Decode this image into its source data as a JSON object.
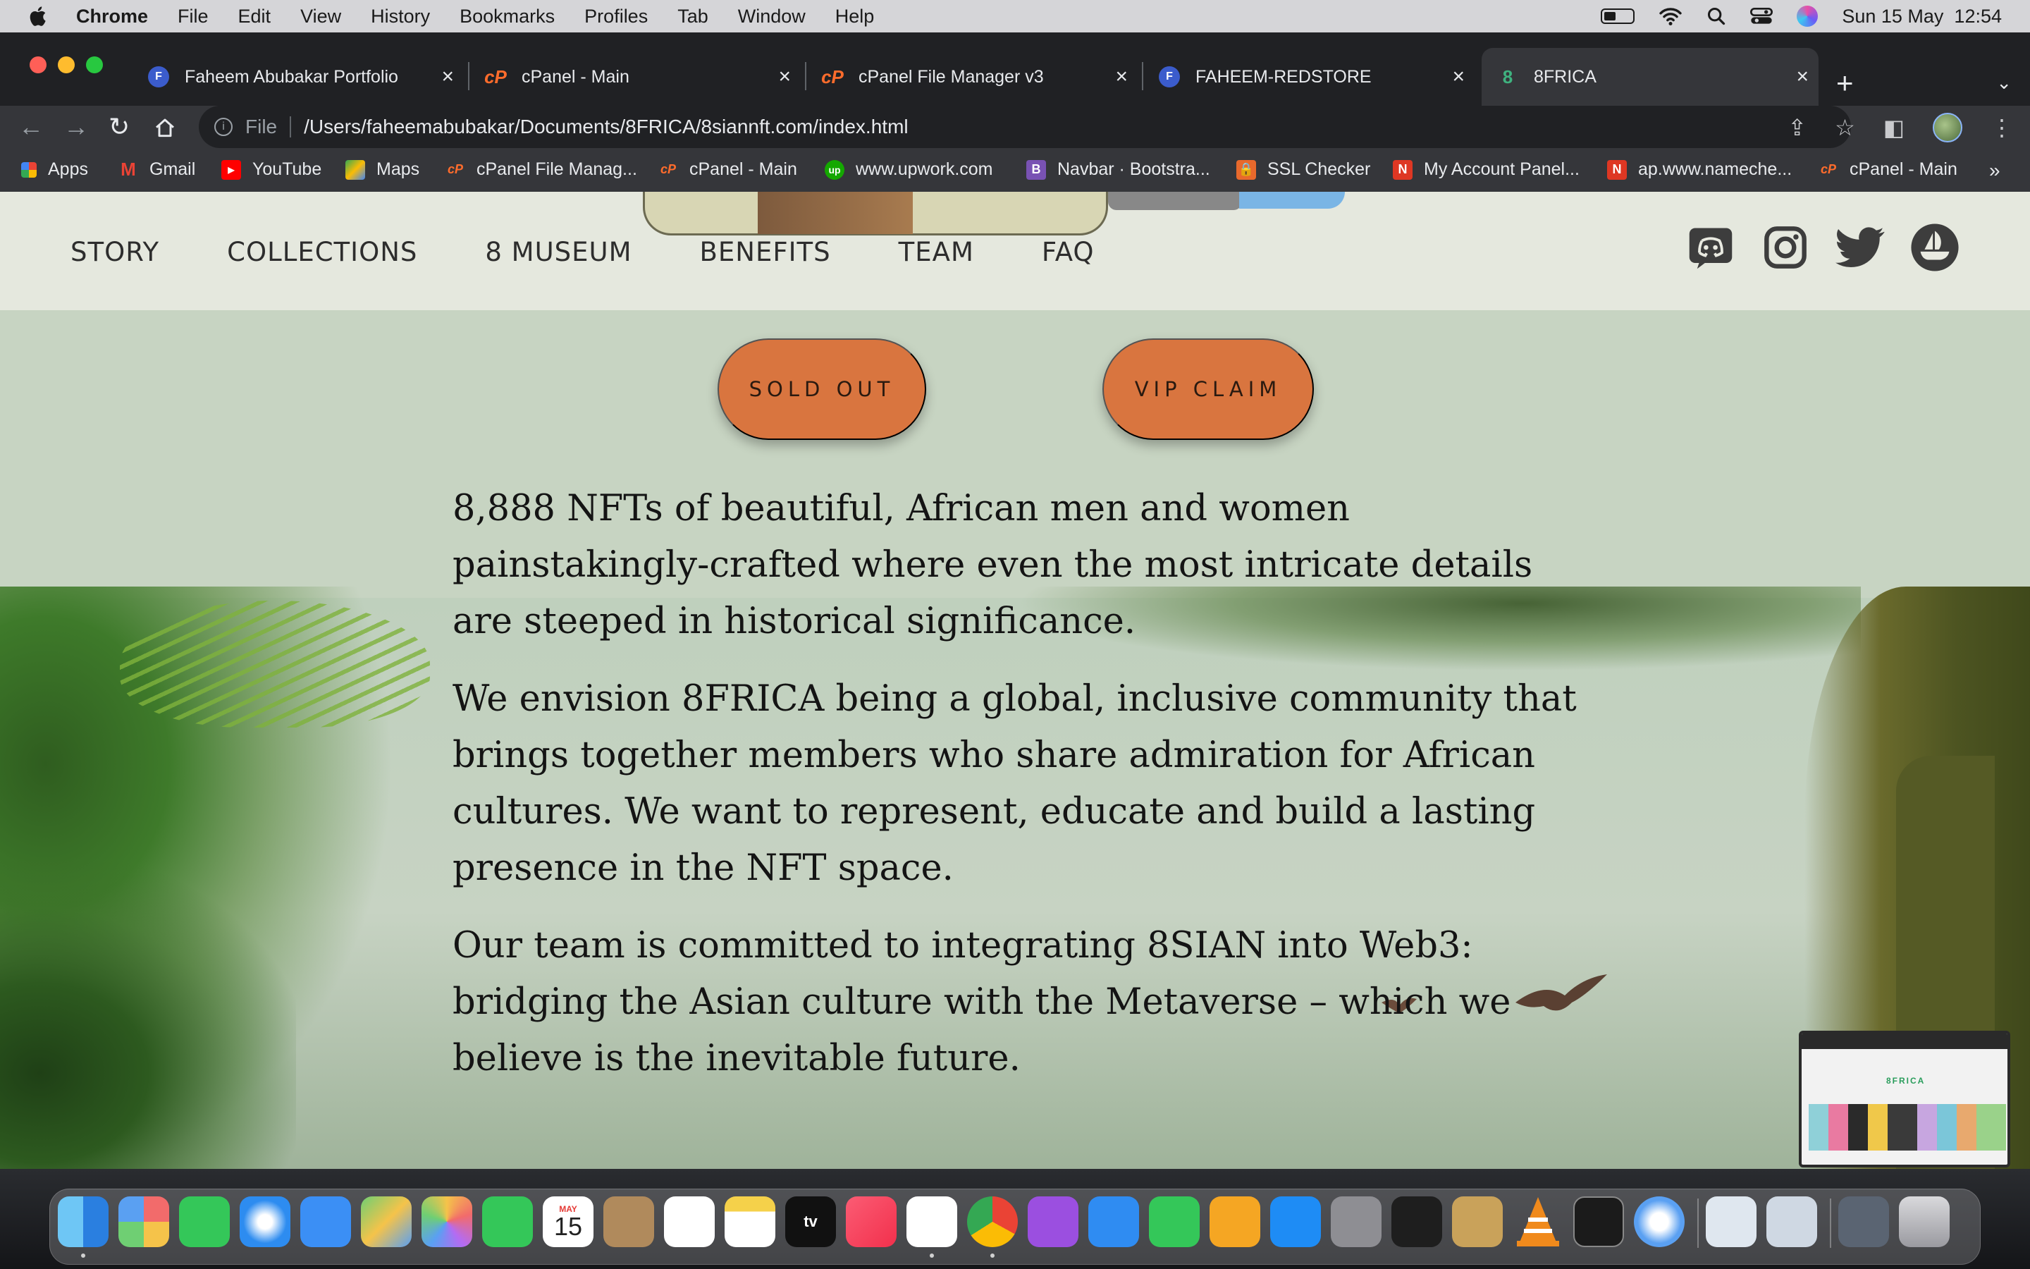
{
  "menubar": {
    "app_name": "Chrome",
    "menus": [
      "File",
      "Edit",
      "View",
      "History",
      "Bookmarks",
      "Profiles",
      "Tab",
      "Window",
      "Help"
    ],
    "datetime": "Sun 15 May  12:54"
  },
  "tabs": [
    {
      "title": "Faheem Abubakar Portfolio",
      "icon": "fa-logo-icon",
      "active": false
    },
    {
      "title": "cPanel - Main",
      "icon": "cpanel-icon",
      "active": false
    },
    {
      "title": "cPanel File Manager v3",
      "icon": "cpanel-icon",
      "active": false
    },
    {
      "title": "FAHEEM-REDSTORE",
      "icon": "fa-logo-icon",
      "active": false
    },
    {
      "title": "8FRICA",
      "icon": "8frica-icon",
      "active": true
    }
  ],
  "address_bar": {
    "scheme": "File",
    "url": "/Users/faheemabubakar/Documents/8FRICA/8siannft.com/index.html"
  },
  "bookmarks": [
    "Apps",
    "Gmail",
    "YouTube",
    "Maps",
    "cPanel File Manag...",
    "cPanel - Main",
    "www.upwork.com",
    "Navbar · Bootstra...",
    "SSL Checker",
    "My Account Panel...",
    "ap.www.nameche...",
    "cPanel - Main"
  ],
  "site": {
    "nav": [
      "STORY",
      "COLLECTIONS",
      "8 MUSEUM",
      "BENEFITS",
      "TEAM",
      "FAQ"
    ],
    "socials": [
      "discord-icon",
      "instagram-icon",
      "twitter-icon",
      "opensea-icon"
    ],
    "buttons": {
      "sold_out": "SOLD OUT",
      "vip_claim": "VIP CLAIM"
    },
    "paragraphs": [
      "8,888 NFTs of beautiful, African men and women painstakingly-crafted where even the most intricate details are steeped in historical significance.",
      "We envision 8FRICA being a global, inclusive community that brings together members who share admiration for African cultures. We want to represent, educate and build a lasting presence in the NFT space.",
      "Our team is committed to integrating 8SIAN into Web3: bridging the Asian culture with the Metaverse – which we believe is the inevitable future."
    ],
    "accent_color": "#d9753f"
  },
  "pip_preview": {
    "logo_text": "8FRICA"
  },
  "dock": {
    "calendar_month": "MAY",
    "calendar_day": "15",
    "tv_label": "tv",
    "apps": [
      "finder-icon",
      "launchpad-icon",
      "messages-icon",
      "safari-icon",
      "mail-icon",
      "maps-icon",
      "photos-icon",
      "facetime-icon",
      "calendar-icon",
      "contacts-icon",
      "reminders-icon",
      "notes-icon",
      "appletv-icon",
      "music-icon",
      "vscode-icon",
      "chrome-icon",
      "podcasts-icon",
      "keynote-icon",
      "numbers-icon",
      "pages-icon",
      "appstore-icon",
      "system-preferences-icon",
      "figma-icon",
      "archive-utility-icon",
      "vlc-icon",
      "terminal-icon",
      "quicktime-icon",
      "preview-icon",
      "screenshot-icon",
      "downloads-folder-icon",
      "trash-icon"
    ]
  }
}
